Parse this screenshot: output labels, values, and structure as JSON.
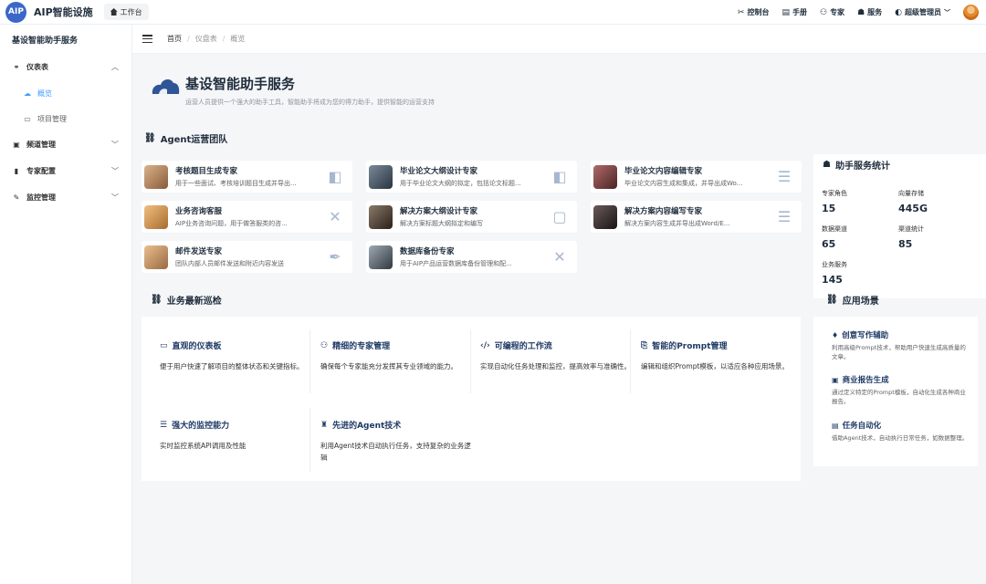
{
  "topbar": {
    "logo_text": "AIP",
    "app_title": "AIP智能设施",
    "home_tab": "工作台",
    "links": [
      {
        "icon": "tools-icon",
        "glyph": "✂",
        "label": "控制台"
      },
      {
        "icon": "manual-icon",
        "glyph": "▤",
        "label": "手册"
      },
      {
        "icon": "expert-icon",
        "glyph": "⚇",
        "label": "专家"
      },
      {
        "icon": "service-icon",
        "glyph": "☗",
        "label": "服务"
      }
    ],
    "user": {
      "glyph": "◐",
      "label": "超级管理员"
    }
  },
  "sidebar": {
    "title": "基设智能助手服务",
    "menu": [
      {
        "label": "仪表表",
        "glyph": "⚭",
        "chevron": "︿"
      },
      {
        "label": "频道管理",
        "glyph": "▣",
        "chevron": "﹀"
      },
      {
        "label": "专家配置",
        "glyph": "▮",
        "chevron": "﹀"
      },
      {
        "label": "监控管理",
        "glyph": "✎",
        "chevron": "﹀"
      }
    ],
    "sub": [
      {
        "label": "概览",
        "glyph": "☁"
      },
      {
        "label": "项目管理",
        "glyph": "▭"
      }
    ]
  },
  "breadcrumb": [
    "首页",
    "仪盘表",
    "概览"
  ],
  "hero": {
    "title": "基设智能助手服务",
    "subtitle": "运营人员提供一个强大的助手工具，智能助手将成为您的得力助手，提供智能的运营支持"
  },
  "agents_section": {
    "title": "Agent运营团队",
    "glyph": "🔗"
  },
  "agents": [
    {
      "name": "考核题目生成专家",
      "desc": "用于一些面试、考核培训题目生成并导出...",
      "avatar": "#c7a17a",
      "icon": "shield-doc-icon",
      "glyph": "◧"
    },
    {
      "name": "毕业论文大纲设计专家",
      "desc": "用于毕业论文大纲的拟定，包括论文标题...",
      "avatar": "#4a5a6a",
      "icon": "shield-doc-icon",
      "glyph": "◧"
    },
    {
      "name": "毕业论文内容编辑专家",
      "desc": "毕业论文内容生成和集成，并导出成Wo...",
      "avatar": "#8a4a4a",
      "icon": "server-icon",
      "glyph": "☰"
    },
    {
      "name": "业务咨询客服",
      "desc": "AIP业务咨询问题，用于做答服类的咨...",
      "avatar": "#e0a060",
      "icon": "tools-icon",
      "glyph": "✕"
    },
    {
      "name": "解决方案大纲设计专家",
      "desc": "解决方案标题大纲拟定和编写",
      "avatar": "#5a4a3a",
      "icon": "train-icon",
      "glyph": "▢"
    },
    {
      "name": "解决方案内容编写专家",
      "desc": "解决方案内容生成并导出成Word/E...",
      "avatar": "#3a3030",
      "icon": "server-icon",
      "glyph": "☰"
    },
    {
      "name": "邮件发送专家",
      "desc": "团队内部人员邮件发送和附近内容发送",
      "avatar": "#d4a878",
      "icon": "feather-icon",
      "glyph": "✒"
    },
    {
      "name": "数据库备份专家",
      "desc": "用于AIP产品运营数据库备份管理和配...",
      "avatar": "#606a74",
      "icon": "tools-icon",
      "glyph": "✕"
    }
  ],
  "stats": {
    "title": "助手服务统计",
    "glyph": "☗",
    "items": [
      {
        "label": "专家角色",
        "value": "15"
      },
      {
        "label": "向量存储",
        "value": "445G"
      },
      {
        "label": "数据渠道",
        "value": "65"
      },
      {
        "label": "渠道统计",
        "value": "85"
      },
      {
        "label": "业务服务",
        "value": "145"
      }
    ]
  },
  "inspection": {
    "title": "业务最新巡检",
    "glyph": "🔗"
  },
  "features": [
    {
      "title": "直观的仪表板",
      "glyph": "▭",
      "desc": "便于用户快速了解项目的整体状态和关键指标。"
    },
    {
      "title": "精细的专家管理",
      "glyph": "⚇",
      "desc": "确保每个专家能充分发挥其专业领域的能力。"
    },
    {
      "title": "可编程的工作流",
      "glyph": "‹/›",
      "desc": "实现自动化任务处理和监控，提高效率与准确性。"
    },
    {
      "title": "智能的Prompt管理",
      "glyph": "⎘",
      "desc": "编辑和组织Prompt模板，以适应各种应用场景。"
    },
    {
      "title": "强大的监控能力",
      "glyph": "☰",
      "desc": "实时监控系统API调用及性能"
    },
    {
      "title": "先进的Agent技术",
      "glyph": "♜",
      "desc": "利用Agent技术自动执行任务，支持复杂的业务逻辑"
    }
  ],
  "scenes_section": {
    "title": "应用场景",
    "glyph": "🔗"
  },
  "scenes": [
    {
      "title": "创意写作辅助",
      "glyph": "♦",
      "desc": "利用高级Prompt技术，帮助用户快速生成高质量的文章。"
    },
    {
      "title": "商业报告生成",
      "glyph": "▣",
      "desc": "通过定义特定的Prompt模板，自动化生成各种商业报告。"
    },
    {
      "title": "任务自动化",
      "glyph": "▤",
      "desc": "借助Agent技术，自动执行日常任务，如数据整理。"
    }
  ]
}
